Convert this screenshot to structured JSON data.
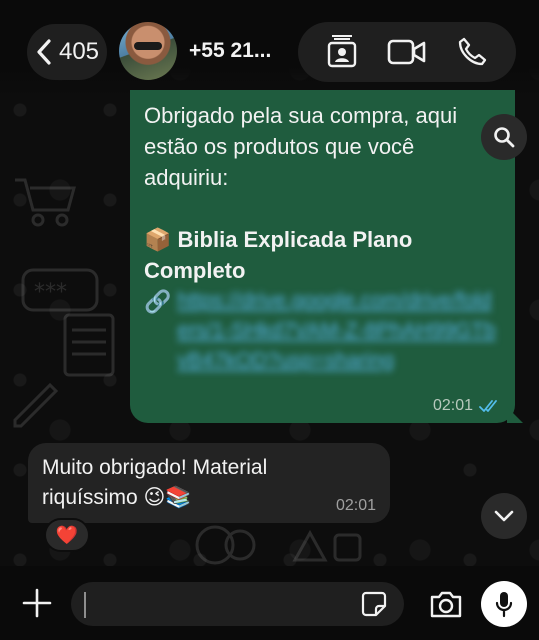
{
  "header": {
    "back_count": "405",
    "contact_name": "+55 21...",
    "icons": [
      "chevron-left-icon",
      "contact-card-icon",
      "video-camera-icon",
      "phone-icon"
    ]
  },
  "messages": {
    "outgoing": {
      "line1": "Obrigado pela sua compra, aqui",
      "line2": "estão os produtos que você",
      "line3": "adquiriu:",
      "product_emoji": "📦",
      "product_line1": "Biblia Explicada Plano",
      "product_line2": "Completo",
      "link_emoji": "🔗",
      "link_text": "https://drive.google.com/drive/folders/1-SHkd7VAM-Z-8PhAH99GTbvB47kOD?usp=sharing",
      "time": "02:01",
      "status": "read"
    },
    "incoming": {
      "line1": "Muito obrigado! Material",
      "line2": "riquíssimo 😉📚",
      "time": "02:01",
      "reaction": "❤️"
    }
  },
  "composer": {
    "input_value": "",
    "icons": [
      "plus-icon",
      "sticker-icon",
      "camera-icon",
      "microphone-icon"
    ]
  },
  "colors": {
    "outgoing_bubble": "#1f5c3e",
    "incoming_bubble": "#232323",
    "link": "#56b3e6",
    "read_ticks": "#53bdeb"
  }
}
